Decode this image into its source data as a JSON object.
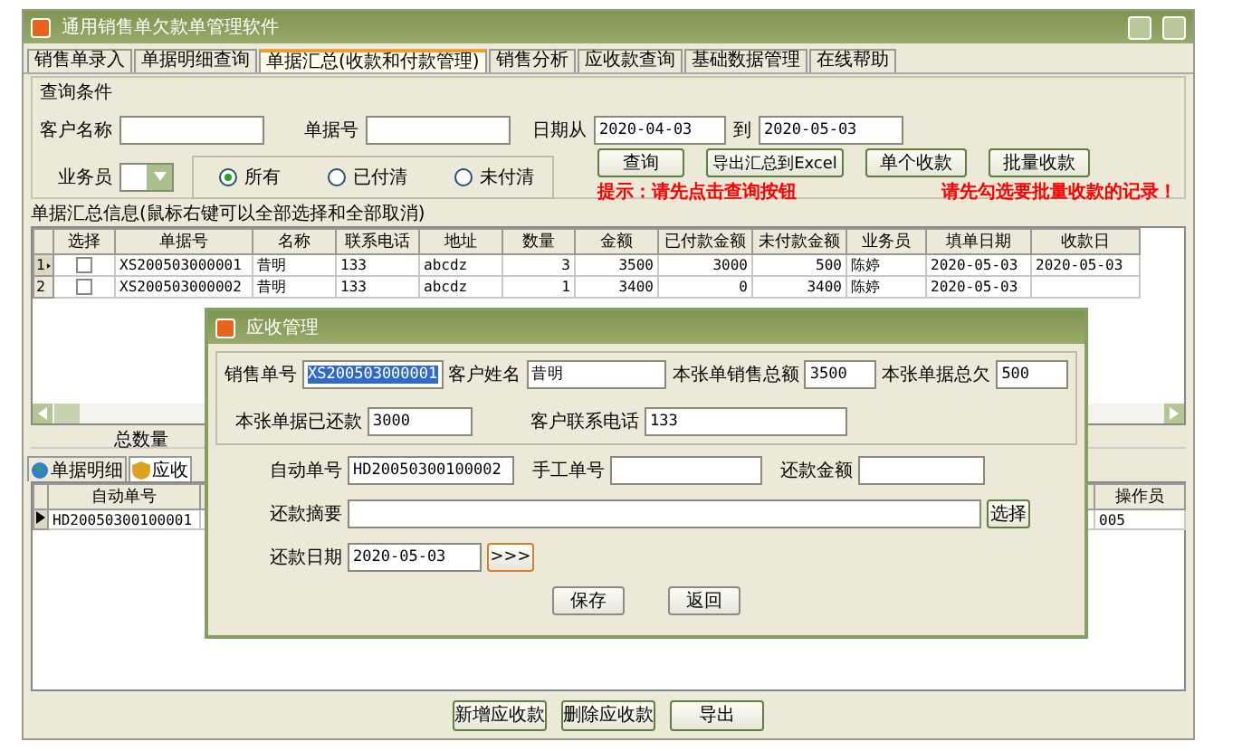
{
  "window": {
    "title": "通用销售单欠款单管理软件"
  },
  "tabs": [
    {
      "label": "销售单录入",
      "selected": false
    },
    {
      "label": "单据明细查询",
      "selected": false
    },
    {
      "label": "单据汇总(收款和付款管理)",
      "selected": true
    },
    {
      "label": "销售分析",
      "selected": false
    },
    {
      "label": "应收款查询",
      "selected": false
    },
    {
      "label": "基础数据管理",
      "selected": false
    },
    {
      "label": "在线帮助",
      "selected": false
    }
  ],
  "query": {
    "title": "查询条件",
    "fields": [
      {
        "label": "客户名称"
      },
      {
        "label": "单据号"
      },
      {
        "label": "日期从",
        "value": "2020-04-03"
      },
      {
        "label": "到",
        "value": "2020-05-03"
      }
    ],
    "salesperson": {
      "label": "业务员"
    },
    "radios": [
      {
        "label": "所有",
        "selected": true
      },
      {
        "label": "已付清",
        "selected": false
      },
      {
        "label": "未付清",
        "selected": false
      }
    ],
    "buttons": [
      "查询",
      "导出汇总到Excel",
      "单个收款",
      "批量收款"
    ],
    "hints": [
      "提示：请先点击查询按钮",
      "请先勾选要批量收款的记录！"
    ]
  },
  "summary": {
    "title": "单据汇总信息(鼠标右键可以全部选择和全部取消)",
    "select_column": "选择",
    "columns": [
      "单据号",
      "名称",
      "联系电话",
      "地址",
      "数量",
      "金额",
      "已付款金额",
      "未付款金额",
      "业务员",
      "填单日期",
      "收款日"
    ],
    "rows": [
      {
        "number": "1",
        "current": true,
        "checked": false,
        "cells": [
          "XS200503000001",
          "昔明",
          "133",
          "abcdz",
          "3",
          "3500",
          "3000",
          "500",
          "陈婷",
          "2020-05-03",
          "2020-05-03"
        ]
      },
      {
        "number": "2",
        "current": false,
        "checked": false,
        "cells": [
          "XS200503000002",
          "昔明",
          "133",
          "abcdz",
          "1",
          "3400",
          "0",
          "3400",
          "陈婷",
          "2020-05-03",
          ""
        ]
      }
    ]
  },
  "total_label": "总数量",
  "detail_tabs": [
    {
      "label": "单据明细",
      "selected": false
    },
    {
      "label": "应收",
      "selected": true
    }
  ],
  "detail_grid": {
    "columns": [
      "自动单号",
      "操作员"
    ],
    "rows": [
      {
        "current": true,
        "cells": [
          "HD20050300100001",
          "005"
        ]
      }
    ]
  },
  "dialog": {
    "title": "应收管理",
    "sale_no": {
      "label": "销售单号",
      "value": "XS200503000001"
    },
    "customer": {
      "label": "客户姓名",
      "value": "昔明"
    },
    "total": {
      "label": "本张单销售总额",
      "value": "3500"
    },
    "owed": {
      "label": "本张单据总欠",
      "value": "500"
    },
    "paid": {
      "label": "本张单据已还款",
      "value": "3000"
    },
    "phone": {
      "label": "客户联系电话",
      "value": "133"
    },
    "auto_no": {
      "label": "自动单号",
      "value": "HD20050300100002"
    },
    "manual_no": {
      "label": "手工单号"
    },
    "amount": {
      "label": "还款金额"
    },
    "memo": {
      "label": "还款摘要"
    },
    "choose_button": "选择",
    "date": {
      "label": "还款日期",
      "value": "2020-05-03"
    },
    "date_button": ">>>",
    "buttons": [
      "保存",
      "返回"
    ]
  },
  "bottom_buttons": [
    "新增应收款",
    "删除应收款",
    "导出"
  ]
}
